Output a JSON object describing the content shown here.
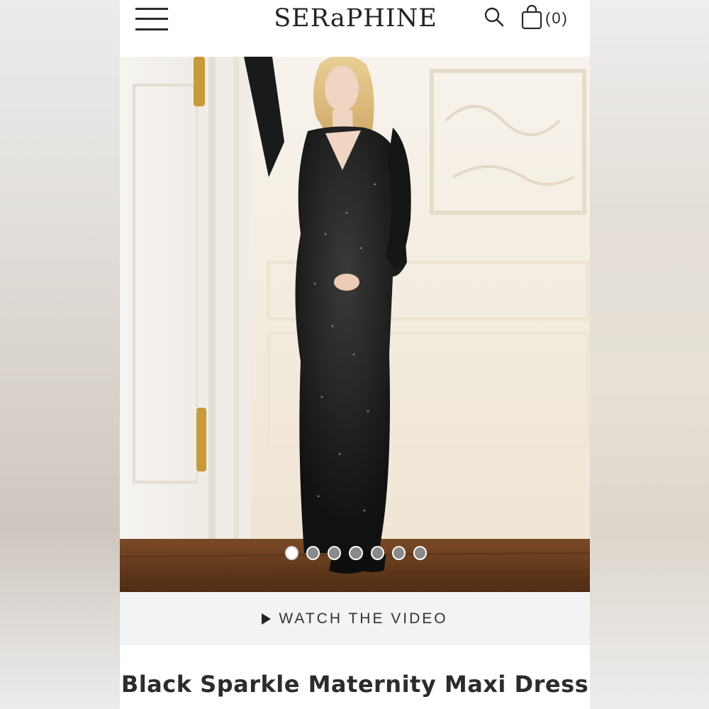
{
  "header": {
    "menu_icon": "hamburger-menu-icon",
    "logo_text": "SERaPHINE",
    "search_icon": "search-icon",
    "cart_icon": "shopping-bag-icon",
    "cart_count": "(0)"
  },
  "gallery": {
    "image_subject": "woman in black sparkle maternity maxi dress",
    "slide_count": 7,
    "active_slide": 1
  },
  "video": {
    "icon": "play-icon",
    "label": "WATCH THE VIDEO"
  },
  "product": {
    "title": "Black Sparkle Maternity Maxi Dress"
  },
  "colors": {
    "background": "#ffffff",
    "video_bar": "#f3f3f3",
    "text": "#2c2c2c"
  }
}
